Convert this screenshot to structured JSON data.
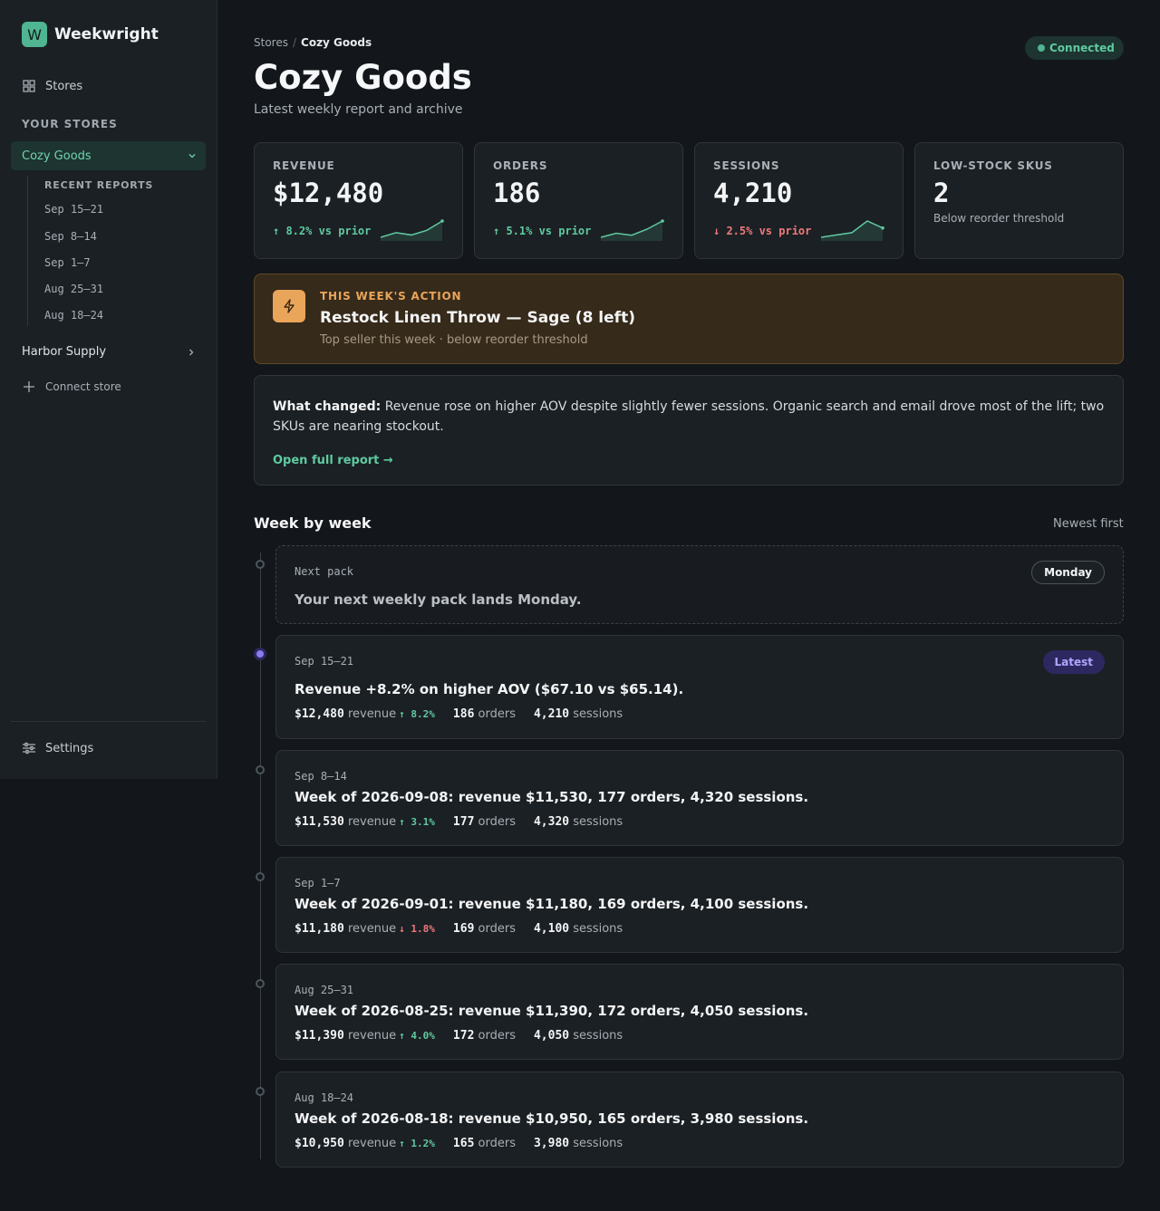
{
  "app": {
    "name": "Weekwright",
    "logo_letter": "W"
  },
  "sidebar": {
    "stores_link": "Stores",
    "section_label": "YOUR STORES",
    "active_store": "Cozy Goods",
    "recent_reports_label": "RECENT REPORTS",
    "recent_reports": [
      "Sep 15–21",
      "Sep 8–14",
      "Sep 1–7",
      "Aug 25–31",
      "Aug 18–24"
    ],
    "other_store": "Harbor Supply",
    "connect_store": "Connect store",
    "settings": "Settings"
  },
  "header": {
    "breadcrumb_root": "Stores",
    "breadcrumb_current": "Cozy Goods",
    "status": "Connected",
    "title": "Cozy Goods",
    "subtitle": "Latest weekly report and archive"
  },
  "kpis": [
    {
      "label": "REVENUE",
      "value": "$12,480",
      "delta": "↑ 8.2% vs prior",
      "direction": "up",
      "spark": [
        3,
        5,
        4,
        6,
        10
      ]
    },
    {
      "label": "ORDERS",
      "value": "186",
      "delta": "↑ 5.1% vs prior",
      "direction": "up",
      "spark": [
        3,
        5,
        4,
        7,
        11
      ]
    },
    {
      "label": "SESSIONS",
      "value": "4,210",
      "delta": "↓ 2.5% vs prior",
      "direction": "down",
      "spark": [
        2,
        3,
        4,
        9,
        6
      ]
    },
    {
      "label": "LOW-STOCK SKUS",
      "value": "2",
      "note": "Below reorder threshold"
    }
  ],
  "action": {
    "kicker": "THIS WEEK'S ACTION",
    "headline": "Restock Linen Throw — Sage (8 left)",
    "meta": "Top seller this week · below reorder threshold"
  },
  "what_changed": {
    "label": "What changed:",
    "text": " Revenue rose on higher AOV despite slightly fewer sessions. Organic search and email drove most of the lift; two SKUs are nearing stockout.",
    "link": "Open full report →"
  },
  "timeline": {
    "title": "Week by week",
    "sort": "Newest first",
    "next": {
      "label": "Next pack",
      "text": "Your next weekly pack lands Monday.",
      "badge": "Monday"
    },
    "weeks": [
      {
        "date": "Sep 15–21",
        "headline": "Revenue +8.2% on higher AOV ($67.10 vs $65.14).",
        "badge": "Latest",
        "revenue": "$12,480",
        "revenue_label": "revenue",
        "delta": "↑ 8.2%",
        "direction": "up",
        "orders": "186",
        "orders_label": "orders",
        "sessions": "4,210",
        "sessions_label": "sessions"
      },
      {
        "date": "Sep 8–14",
        "headline": "Week of 2026-09-08: revenue $11,530, 177 orders, 4,320 sessions.",
        "revenue": "$11,530",
        "revenue_label": "revenue",
        "delta": "↑ 3.1%",
        "direction": "up",
        "orders": "177",
        "orders_label": "orders",
        "sessions": "4,320",
        "sessions_label": "sessions"
      },
      {
        "date": "Sep 1–7",
        "headline": "Week of 2026-09-01: revenue $11,180, 169 orders, 4,100 sessions.",
        "revenue": "$11,180",
        "revenue_label": "revenue",
        "delta": "↓ 1.8%",
        "direction": "down",
        "orders": "169",
        "orders_label": "orders",
        "sessions": "4,100",
        "sessions_label": "sessions"
      },
      {
        "date": "Aug 25–31",
        "headline": "Week of 2026-08-25: revenue $11,390, 172 orders, 4,050 sessions.",
        "revenue": "$11,390",
        "revenue_label": "revenue",
        "delta": "↑ 4.0%",
        "direction": "up",
        "orders": "172",
        "orders_label": "orders",
        "sessions": "4,050",
        "sessions_label": "sessions"
      },
      {
        "date": "Aug 18–24",
        "headline": "Week of 2026-08-18: revenue $10,950, 165 orders, 3,980 sessions.",
        "revenue": "$10,950",
        "revenue_label": "revenue",
        "delta": "↑ 1.2%",
        "direction": "up",
        "orders": "165",
        "orders_label": "orders",
        "sessions": "3,980",
        "sessions_label": "sessions"
      }
    ]
  },
  "colors": {
    "accent": "#4fb592",
    "up": "#5fcaa0",
    "down": "#ef7a7a",
    "action": "#e9a55a",
    "latest": "#8b7cf0"
  }
}
